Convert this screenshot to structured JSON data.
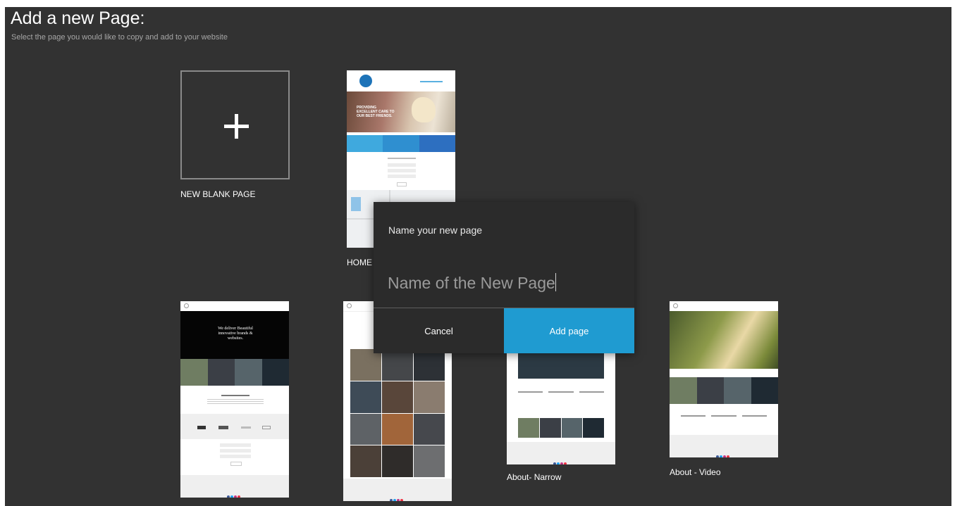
{
  "header": {
    "title": "Add a new Page:",
    "subtitle": "Select the page you would like to copy and add to your website"
  },
  "cards": {
    "blank": {
      "label": "NEW BLANK PAGE",
      "icon": "plus-icon"
    },
    "home": {
      "label": "HOME",
      "hero_text": "PROVIDING EXCELLENT CARE TO OUR BEST FRIENDS."
    },
    "gallery_dark": {
      "label": "",
      "hero_text": "We deliver Beautiful innovative brands & websites."
    },
    "gallery_grid": {
      "label": ""
    },
    "about_narrow": {
      "label": "About- Narrow"
    },
    "about_video": {
      "label": "About - Video"
    }
  },
  "modal": {
    "title": "Name your new page",
    "input_placeholder": "Name of the New Page",
    "input_value": "",
    "cancel_label": "Cancel",
    "add_label": "Add page"
  },
  "colors": {
    "background": "#323232",
    "modal_bg": "#2b2b2b",
    "accent": "#1f9bd1"
  }
}
